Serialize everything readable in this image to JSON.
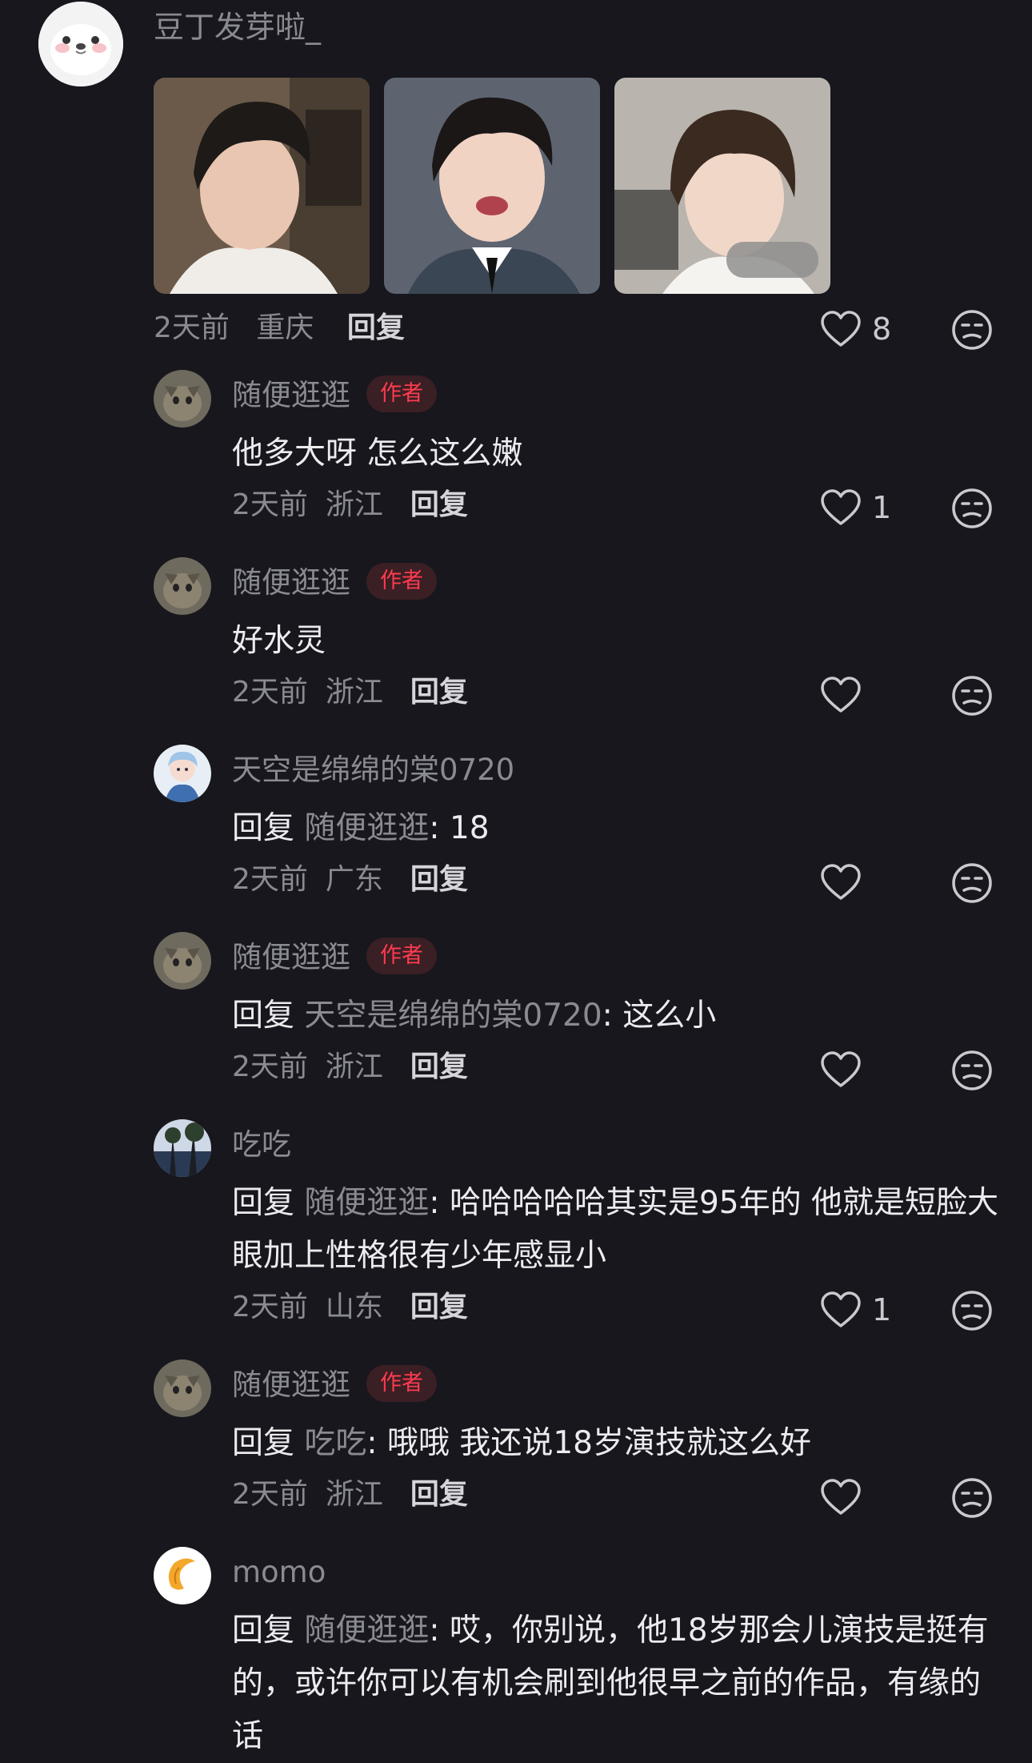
{
  "top_comment": {
    "username": "豆丁发芽啦_",
    "time": "2天前",
    "location": "重庆",
    "reply_label": "回复",
    "like_count": "8"
  },
  "replies": [
    {
      "name": "随便逛逛",
      "author_badge": "作者",
      "reply_word": "",
      "reply_target": "",
      "text": "他多大呀 怎么这么嫩",
      "time": "2天前",
      "location": "浙江",
      "reply_label": "回复",
      "like_count": "1"
    },
    {
      "name": "随便逛逛",
      "author_badge": "作者",
      "reply_word": "",
      "reply_target": "",
      "text": "好水灵",
      "time": "2天前",
      "location": "浙江",
      "reply_label": "回复",
      "like_count": ""
    },
    {
      "name": "天空是绵绵的棠0720",
      "author_badge": "",
      "reply_word": "回复 ",
      "reply_target": "随便逛逛",
      "text": ": 18",
      "time": "2天前",
      "location": "广东",
      "reply_label": "回复",
      "like_count": ""
    },
    {
      "name": "随便逛逛",
      "author_badge": "作者",
      "reply_word": "回复 ",
      "reply_target": "天空是绵绵的棠0720",
      "text": ": 这么小",
      "time": "2天前",
      "location": "浙江",
      "reply_label": "回复",
      "like_count": ""
    },
    {
      "name": "吃吃",
      "author_badge": "",
      "reply_word": "回复 ",
      "reply_target": "随便逛逛",
      "text": ": 哈哈哈哈哈其实是95年的  他就是短脸大眼加上性格很有少年感显小",
      "time": "2天前",
      "location": "山东",
      "reply_label": "回复",
      "like_count": "1"
    },
    {
      "name": "随便逛逛",
      "author_badge": "作者",
      "reply_word": "回复 ",
      "reply_target": "吃吃",
      "text": ": 哦哦 我还说18岁演技就这么好",
      "time": "2天前",
      "location": "浙江",
      "reply_label": "回复",
      "like_count": ""
    },
    {
      "name": "momo",
      "author_badge": "",
      "reply_word": "回复 ",
      "reply_target": "随便逛逛",
      "text": ": 哎，你别说，他18岁那会儿演技是挺有的，或许你可以有机会刷到他很早之前的作品，有缘的话",
      "time": "",
      "location": "",
      "reply_label": "",
      "like_count": ""
    }
  ],
  "icons": {
    "like": "heart-outline-icon",
    "dislike": "unamused-face-icon"
  },
  "colors": {
    "background": "#17171d",
    "muted_text": "#8a8a91",
    "author_badge_text": "#ff3b4e",
    "author_badge_bg": "#3a1f24"
  }
}
